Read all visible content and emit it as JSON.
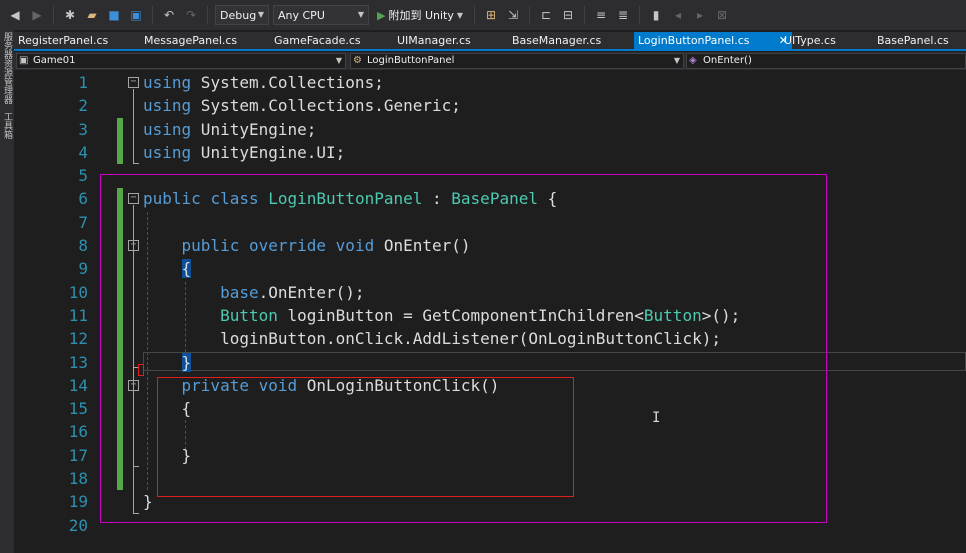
{
  "toolbar": {
    "config": "Debug",
    "platform": "Any CPU",
    "attach_label": "附加到 Unity"
  },
  "left_strip": {
    "label1": "服务器资源管理器",
    "label2": "工具箱"
  },
  "tabs": [
    {
      "label": "RegisterPanel.cs",
      "active": false
    },
    {
      "label": "MessagePanel.cs",
      "active": false
    },
    {
      "label": "GameFacade.cs",
      "active": false
    },
    {
      "label": "UIManager.cs",
      "active": false
    },
    {
      "label": "BaseManager.cs",
      "active": false
    },
    {
      "label": "LoginButtonPanel.cs",
      "active": true
    },
    {
      "label": "UIType.cs",
      "active": false
    },
    {
      "label": "BasePanel.cs",
      "active": false
    }
  ],
  "navbar": {
    "project": "Game01",
    "class": "LoginButtonPanel",
    "member": "OnEnter()"
  },
  "line_numbers": [
    "1",
    "2",
    "3",
    "4",
    "5",
    "6",
    "7",
    "8",
    "9",
    "10",
    "11",
    "12",
    "13",
    "14",
    "15",
    "16",
    "17",
    "18",
    "19",
    "20"
  ],
  "code": {
    "l1": {
      "kw": "using",
      "rest": " System.Collections;"
    },
    "l2": {
      "kw": "using",
      "rest": " System.Collections.Generic;"
    },
    "l3": {
      "kw": "using",
      "rest": " UnityEngine;"
    },
    "l4": {
      "kw": "using",
      "rest": " UnityEngine.UI;"
    },
    "l6": {
      "kw1": "public",
      "kw2": "class",
      "name": "LoginButtonPanel",
      "colon": " : ",
      "base": "BasePanel",
      "brace": " {"
    },
    "l8": {
      "kw1": "public",
      "kw2": "override",
      "kw3": "void",
      "rest": " OnEnter()"
    },
    "l9": {
      "brace": "{"
    },
    "l10": {
      "kw": "base",
      "rest": ".OnEnter();"
    },
    "l11": {
      "type": "Button",
      "mid": " loginButton = GetComponentInChildren<",
      "type2": "Button",
      "end": ">();"
    },
    "l12": {
      "text": "loginButton.onClick.AddListener(OnLoginButtonClick);"
    },
    "l13": {
      "brace": "}"
    },
    "l14": {
      "kw1": "private",
      "kw2": "void",
      "rest": " OnLoginButtonClick()"
    },
    "l15": {
      "brace": "{"
    },
    "l17": {
      "brace": "}"
    },
    "l19": {
      "brace": "}"
    }
  },
  "icons": [
    "back-icon",
    "forward-icon",
    "new-project-icon",
    "open-icon",
    "save-icon",
    "save-all-icon",
    "undo-icon",
    "redo-icon",
    "play-icon",
    "bookmark-icon",
    "close-icon",
    "class-icon",
    "method-icon"
  ],
  "colors": {
    "keyword": "#569cd6",
    "type": "#4ec9b0",
    "line_number": "#2b91af",
    "highlight_box": "#c800c8",
    "annotation_box": "#e01e1e",
    "change_bar": "#57a64a",
    "accent": "#007acc"
  }
}
